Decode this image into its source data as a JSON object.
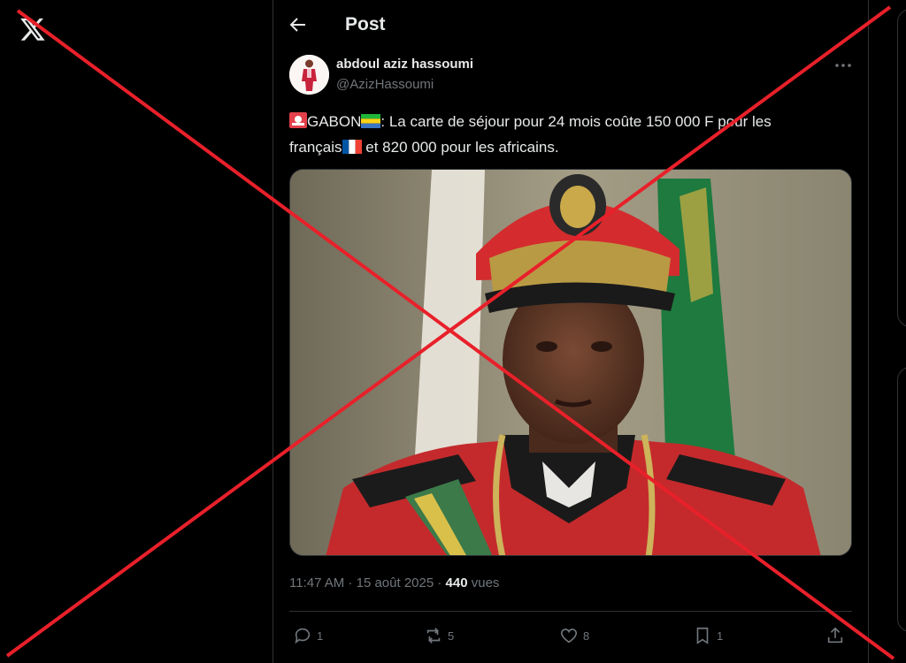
{
  "header": {
    "title": "Post"
  },
  "author": {
    "name": "abdoul aziz hassoumi",
    "handle": "@AzizHassoumi"
  },
  "tweet": {
    "prefix": "GABON",
    "line1": ": La carte de séjour pour 24 mois coûte 150 000 F pour les",
    "line2_a": "français",
    "line2_b": " et 820 000 pour les africains."
  },
  "meta": {
    "time": "11:47 AM",
    "date": "15 août 2025",
    "views_count": "440",
    "views_label": "vues"
  },
  "actions": {
    "replies": "1",
    "reposts": "5",
    "likes": "8",
    "bookmarks": "1"
  },
  "icons": [
    "x-logo-icon",
    "back-arrow-icon",
    "more-icon",
    "siren-emoji-icon",
    "gabon-flag-icon",
    "france-flag-icon",
    "reply-icon",
    "repost-icon",
    "like-icon",
    "bookmark-icon",
    "share-icon"
  ],
  "colors": {
    "background": "#000000",
    "text": "#e7e9ea",
    "secondary": "#71767b",
    "divider": "#2f3336",
    "cross": "#e8202a"
  }
}
